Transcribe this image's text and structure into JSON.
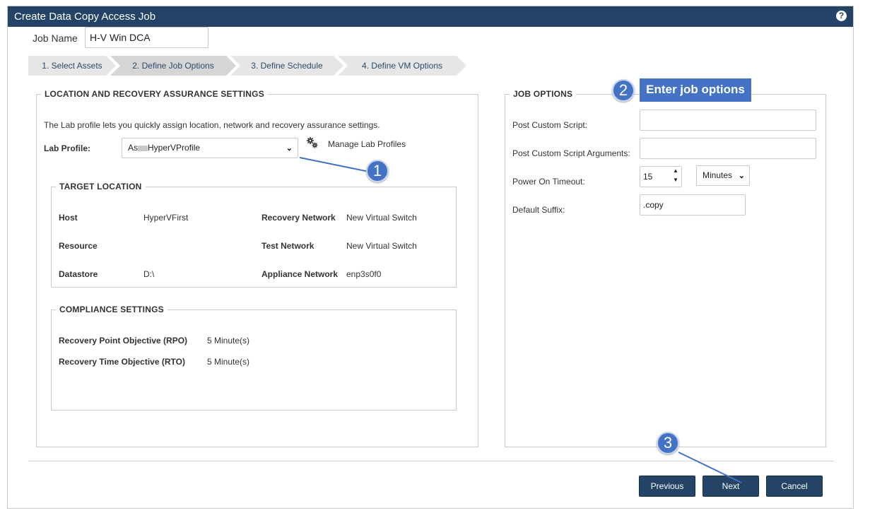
{
  "window": {
    "title": "Create Data Copy Access Job",
    "help_icon": "?"
  },
  "job_name": {
    "label": "Job Name",
    "value": "H-V Win DCA"
  },
  "wizard_steps": [
    {
      "label": "1. Select Assets",
      "active": false
    },
    {
      "label": "2. Define Job Options",
      "active": true
    },
    {
      "label": "3. Define Schedule",
      "active": false
    },
    {
      "label": "4. Define VM Options",
      "active": false
    }
  ],
  "location_section": {
    "legend": "LOCATION AND RECOVERY ASSURANCE SETTINGS",
    "description": "The Lab profile lets you quickly assign location, network and recovery assurance settings.",
    "lab_profile_label": "Lab Profile:",
    "lab_profile_value_prefix": "As",
    "lab_profile_value_suffix": "HyperVProfile",
    "manage_link": "Manage Lab Profiles",
    "manage_icon": "gears-icon"
  },
  "target_location": {
    "legend": "TARGET LOCATION",
    "host_label": "Host",
    "host_value": "HyperVFirst",
    "resource_label": "Resource",
    "resource_value": "",
    "datastore_label": "Datastore",
    "datastore_value": "D:\\",
    "recovery_network_label": "Recovery Network",
    "recovery_network_value": "New Virtual Switch",
    "test_network_label": "Test Network",
    "test_network_value": "New Virtual Switch",
    "appliance_network_label": "Appliance Network",
    "appliance_network_value": "enp3s0f0"
  },
  "compliance": {
    "legend": "COMPLIANCE SETTINGS",
    "rpo_label": "Recovery Point Objective (RPO)",
    "rpo_value": "5 Minute(s)",
    "rto_label": "Recovery Time Objective (RTO)",
    "rto_value": "5 Minute(s)"
  },
  "job_options": {
    "legend": "JOB OPTIONS",
    "post_script_label": "Post Custom Script:",
    "post_script_value": "",
    "post_script_args_label": "Post Custom Script Arguments:",
    "post_script_args_value": "",
    "power_on_timeout_label": "Power On Timeout:",
    "power_on_timeout_value": "15",
    "power_on_timeout_unit": "Minutes",
    "default_suffix_label": "Default Suffix:",
    "default_suffix_value": ".copy"
  },
  "buttons": {
    "previous": "Previous",
    "next": "Next",
    "cancel": "Cancel"
  },
  "callouts": {
    "one": "1",
    "two": "2",
    "two_label": "Enter job options",
    "three": "3",
    "color": "#4472c4"
  },
  "colors": {
    "titlebar": "#234466",
    "button": "#234466",
    "step_inactive": "#e6e6e6",
    "step_active": "#d5d5d5"
  }
}
